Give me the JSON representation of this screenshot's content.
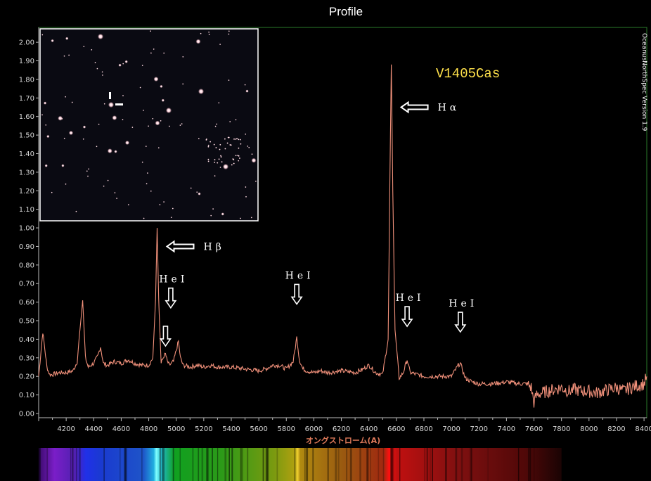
{
  "window": {
    "title": "Profile",
    "software_label": "OceanusNorthSpec Version 1.9"
  },
  "chart_data": {
    "type": "line",
    "title": "Profile",
    "xlabel": "オングストローム(A)",
    "ylabel": "",
    "xlim": [
      4000,
      8420
    ],
    "ylim": [
      0,
      2.08
    ],
    "x_ticks": [
      4200,
      4400,
      4600,
      4800,
      5000,
      5200,
      5400,
      5600,
      5800,
      6000,
      6200,
      6400,
      6600,
      6800,
      7000,
      7200,
      7400,
      7600,
      7800,
      8000,
      8200,
      8400
    ],
    "y_ticks": [
      "0.00",
      "0.10",
      "0.20",
      "0.30",
      "0.40",
      "0.50",
      "0.60",
      "0.70",
      "0.80",
      "0.90",
      "1.00",
      "1.10",
      "1.20",
      "1.30",
      "1.40",
      "1.50",
      "1.60",
      "1.70",
      "1.80",
      "1.90",
      "2.00"
    ],
    "grid": false,
    "series": [
      {
        "name": "",
        "color": "#f0907a",
        "x": [
          4000,
          4030,
          4060,
          4080,
          4100,
          4150,
          4200,
          4250,
          4280,
          4300,
          4320,
          4340,
          4360,
          4400,
          4430,
          4450,
          4470,
          4500,
          4550,
          4600,
          4650,
          4700,
          4750,
          4800,
          4830,
          4850,
          4861,
          4872,
          4890,
          4910,
          4922,
          4935,
          4950,
          4980,
          5000,
          5016,
          5030,
          5050,
          5100,
          5150,
          5200,
          5250,
          5300,
          5400,
          5500,
          5600,
          5650,
          5700,
          5750,
          5800,
          5850,
          5876,
          5895,
          5920,
          5950,
          6000,
          6050,
          6100,
          6200,
          6300,
          6360,
          6400,
          6450,
          6500,
          6540,
          6552,
          6563,
          6574,
          6590,
          6620,
          6650,
          6678,
          6700,
          6750,
          6800,
          6900,
          7000,
          7050,
          7065,
          7100,
          7150,
          7200,
          7300,
          7400,
          7500,
          7550,
          7580,
          7600,
          7620,
          7650,
          7700,
          7750,
          7800,
          7850,
          7900,
          7950,
          8000,
          8050,
          8100,
          8150,
          8200,
          8250,
          8300,
          8350,
          8400,
          8420
        ],
        "y": [
          0.2,
          0.44,
          0.25,
          0.21,
          0.21,
          0.22,
          0.22,
          0.23,
          0.28,
          0.45,
          0.61,
          0.3,
          0.25,
          0.27,
          0.31,
          0.36,
          0.27,
          0.26,
          0.28,
          0.27,
          0.29,
          0.27,
          0.26,
          0.26,
          0.3,
          0.62,
          1.0,
          0.62,
          0.27,
          0.31,
          0.32,
          0.28,
          0.26,
          0.28,
          0.34,
          0.39,
          0.3,
          0.26,
          0.25,
          0.26,
          0.25,
          0.26,
          0.25,
          0.25,
          0.24,
          0.23,
          0.24,
          0.26,
          0.26,
          0.24,
          0.28,
          0.41,
          0.29,
          0.24,
          0.23,
          0.22,
          0.23,
          0.22,
          0.23,
          0.22,
          0.24,
          0.26,
          0.22,
          0.21,
          0.4,
          1.2,
          1.88,
          1.2,
          0.45,
          0.19,
          0.22,
          0.29,
          0.22,
          0.21,
          0.2,
          0.2,
          0.2,
          0.26,
          0.27,
          0.19,
          0.17,
          0.16,
          0.16,
          0.17,
          0.16,
          0.16,
          0.14,
          0.06,
          0.1,
          0.11,
          0.12,
          0.13,
          0.14,
          0.12,
          0.13,
          0.12,
          0.12,
          0.11,
          0.12,
          0.13,
          0.14,
          0.12,
          0.14,
          0.15,
          0.16,
          0.2
        ]
      }
    ],
    "annotations": [
      {
        "text": "Hα",
        "x": 6563,
        "y": 1.65,
        "arrow": "left"
      },
      {
        "text": "Hβ",
        "x": 4861,
        "y": 0.9,
        "arrow": "left"
      },
      {
        "text": "HeI",
        "x": 4960,
        "y": 0.63,
        "arrow": "down"
      },
      {
        "text": "HeI",
        "x": 5876,
        "y": 0.65,
        "arrow": "down"
      },
      {
        "text": "HeI",
        "x": 6678,
        "y": 0.53,
        "arrow": "down"
      },
      {
        "text": "HeI",
        "x": 7065,
        "y": 0.5,
        "arrow": "down"
      }
    ],
    "star_label": "V1405Cas",
    "colors": {
      "background": "#000000",
      "frame": "#2a7a2a",
      "spectrum": "#f0907a",
      "star_label": "#ffe14a",
      "axis_text": "#d8d8d8"
    }
  },
  "inset_image": {
    "description_icon": "star-field-thumbnail",
    "marker_icon": "target-marker-icon"
  },
  "spectrum_strip": {
    "icon": "color-spectrum-strip"
  }
}
